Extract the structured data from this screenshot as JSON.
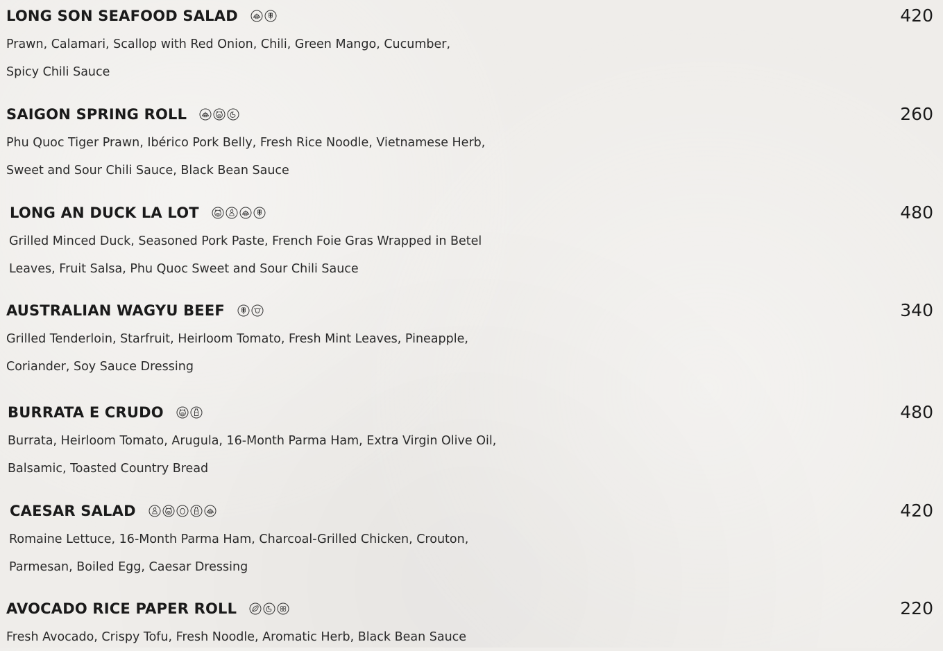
{
  "items": [
    {
      "name": "LONG SON SEAFOOD SALAD",
      "icons": [
        "shellfish-icon",
        "gluten-icon"
      ],
      "price": "420",
      "desc": [
        "Prawn, Calamari, Scallop with Red Onion, Chili, Green Mango, Cucumber,",
        "Spicy Chili Sauce"
      ]
    },
    {
      "name": "SAIGON SPRING ROLL",
      "icons": [
        "shellfish-icon",
        "pork-icon",
        "soy-icon"
      ],
      "price": "260",
      "desc": [
        "Phu Quoc Tiger Prawn, Ibérico Pork Belly, Fresh Rice Noodle, Vietnamese Herb,",
        "Sweet and Sour Chili Sauce, Black Bean Sauce"
      ]
    },
    {
      "name": "LONG AN DUCK LA LOT",
      "icons": [
        "pork-icon",
        "poultry-icon",
        "shellfish-icon",
        "gluten-icon"
      ],
      "price": "480",
      "desc": [
        "Grilled Minced Duck, Seasoned Pork Paste, French Foie Gras Wrapped in Betel",
        "Leaves, Fruit Salsa, Phu Quoc Sweet and Sour Chili Sauce"
      ]
    },
    {
      "name": "AUSTRALIAN WAGYU BEEF",
      "icons": [
        "gluten-icon",
        "beef-icon"
      ],
      "price": "340",
      "desc": [
        "Grilled Tenderloin, Starfruit, Heirloom Tomato, Fresh Mint Leaves, Pineapple,",
        "Coriander, Soy Sauce Dressing"
      ]
    },
    {
      "name": "BURRATA E CRUDO",
      "icons": [
        "pork-icon",
        "dairy-icon"
      ],
      "price": "480",
      "desc": [
        "Burrata, Heirloom Tomato, Arugula, 16-Month Parma Ham, Extra Virgin Olive Oil,",
        "Balsamic, Toasted Country Bread"
      ]
    },
    {
      "name": "CAESAR SALAD",
      "icons": [
        "poultry-icon",
        "pork-icon",
        "egg-icon",
        "dairy-icon",
        "shellfish-icon"
      ],
      "price": "420",
      "desc": [
        "Romaine Lettuce, 16-Month Parma Ham, Charcoal-Grilled Chicken, Crouton,",
        "Parmesan, Boiled Egg, Caesar Dressing"
      ]
    },
    {
      "name": "AVOCADO RICE PAPER ROLL",
      "icons": [
        "vegan-icon",
        "soy-icon",
        "nuts-icon"
      ],
      "price": "220",
      "desc": [
        "Fresh Avocado, Crispy Tofu, Fresh Noodle, Aromatic Herb, Black Bean Sauce"
      ]
    }
  ]
}
